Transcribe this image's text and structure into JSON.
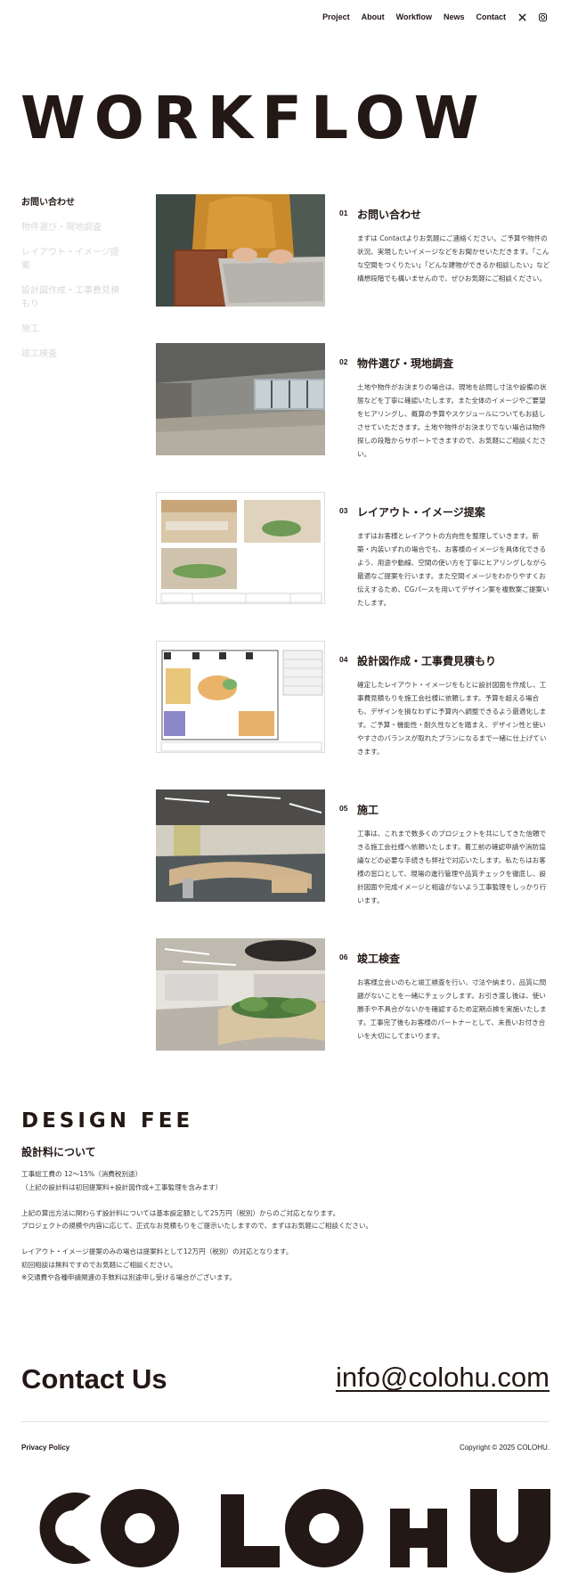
{
  "nav": {
    "items": [
      "Project",
      "About",
      "Workflow",
      "News",
      "Contact"
    ],
    "icons": [
      "x-icon",
      "instagram-icon"
    ]
  },
  "hero": {
    "title": "WORKFLOW"
  },
  "sidebar": {
    "items": [
      {
        "label": "お問い合わせ",
        "active": true
      },
      {
        "label": "物件選び・現地調査",
        "active": false
      },
      {
        "label": "レイアウト・イメージ提案",
        "active": false
      },
      {
        "label": "設計図作成・工事費見積もり",
        "active": false
      },
      {
        "label": "施工",
        "active": false
      },
      {
        "label": "竣工検査",
        "active": false
      }
    ]
  },
  "steps": [
    {
      "num": "01",
      "title": "お問い合わせ",
      "text": "まずは Contactよりお気軽にご連絡ください。ご予算や物件の状況、実現したいイメージなどをお聞かせいただきます。「こんな空間をつくりたい」「どんな建物ができるか相談したい」など構想段階でも構いませんので、ぜひお気軽にご相談ください。"
    },
    {
      "num": "02",
      "title": "物件選び・現地調査",
      "text": "土地や物件がお決まりの場合は、現地を訪問し寸法や設備の状態などを丁寧に確認いたします。また全体のイメージやご要望をヒアリングし、概算の予算やスケジュールについてもお話しさせていただきます。土地や物件がお決まりでない場合は物件探しの段階からサポートできますので、お気軽にご相談ください。"
    },
    {
      "num": "03",
      "title": "レイアウト・イメージ提案",
      "text": "まずはお客様とレイアウトの方向性を整理していきます。新築・内装いずれの場合でも、お客様のイメージを具体化できるよう、用途や動線、空間の使い方を丁寧にヒアリングしながら最適なご提案を行います。また空間イメージをわかりやすくお伝えするため、CGパースを用いてデザイン案を複数案ご提案いたします。"
    },
    {
      "num": "04",
      "title": "設計図作成・工事費見積もり",
      "text": "確定したレイアウト・イメージをもとに設計図面を作成し、工事費見積もりを施工会社様に依頼します。予算を超える場合も、デザインを損なわずに予算内へ調整できるよう最適化します。ご予算・機能性・耐久性などを踏まえ、デザイン性と使いやすさのバランスが取れたプランになるまで一緒に仕上げていきます。"
    },
    {
      "num": "05",
      "title": "施工",
      "text": "工事は、これまで数多くのプロジェクトを共にしてきた信頼できる施工会社様へ依頼いたします。着工前の確認申請や消防協議などの必要な手続きも弊社で対応いたします。私たちはお客様の窓口として、現場の進行管理や品質チェックを徹底し、設計図面や完成イメージと相違がないよう工事監理をしっかり行います。"
    },
    {
      "num": "06",
      "title": "竣工検査",
      "text": "お客様立会いのもと竣工検査を行い、寸法や納まり、品質に問題がないことを一緒にチェックします。お引き渡し後は、使い勝手や不具合がないかを確認するため定期点検を実施いたします。工事完了後もお客様のパートナーとして、末長いお付き合いを大切にしてまいります。"
    }
  ],
  "fee": {
    "title": "DESIGN FEE",
    "subtitle": "設計料について",
    "paragraphs": [
      [
        "工事総工費の 12〜15%（消費税別途）",
        "（上記の設計料は初回提案料+設計図作成+工事監理を含みます）"
      ],
      [
        "上記の算出方法に関わらず設計料については基本設定額として25万円（税別）からのご対応となります。",
        "プロジェクトの規模や内容に応じて、正式なお見積もりをご提示いたしますので、まずはお気軽にご相談ください。"
      ],
      [
        "レイアウト・イメージ提案のみの場合は提案料として12万円（税別）の対応となります。",
        "初回相談は無料ですのでお気軽にご相談ください。",
        "※交通費や各種申請関連の手数料は別途申し受ける場合がございます。"
      ]
    ]
  },
  "contact": {
    "heading": "Contact Us",
    "email": "info@colohu.com"
  },
  "footer": {
    "privacy": "Privacy Policy",
    "copyright": "Copyright © 2025 COLOHU."
  },
  "logo": {
    "text": "COLOHU"
  },
  "colors": {
    "ink": "#231815",
    "muted": "#d9d9d9",
    "body_text": "#3a3a3a"
  }
}
